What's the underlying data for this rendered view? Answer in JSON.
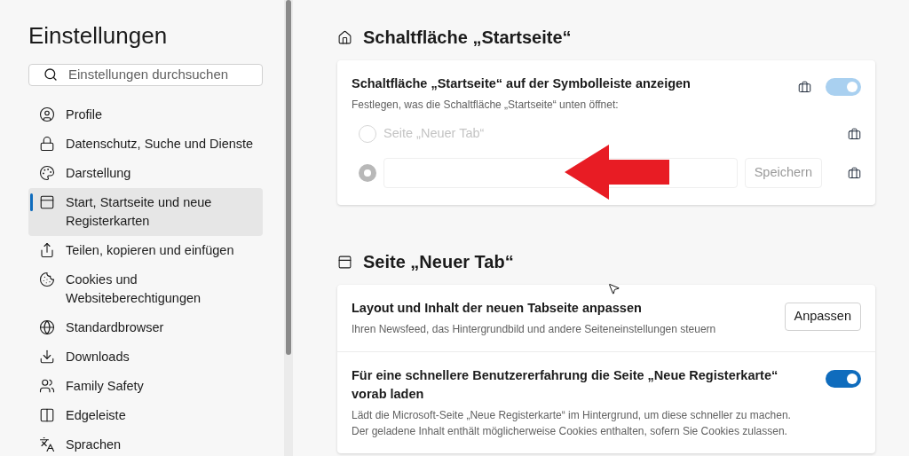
{
  "sidebar": {
    "title": "Einstellungen",
    "search": {
      "placeholder": "Einstellungen durchsuchen"
    },
    "items": [
      {
        "label": "Profile",
        "selected": false
      },
      {
        "label": "Datenschutz, Suche und Dienste",
        "selected": false
      },
      {
        "label": "Darstellung",
        "selected": false
      },
      {
        "label": "Start, Startseite und neue Registerkarten",
        "selected": true
      },
      {
        "label": "Teilen, kopieren und einfügen",
        "selected": false
      },
      {
        "label": "Cookies und Websiteberechtigungen",
        "selected": false
      },
      {
        "label": "Standardbrowser",
        "selected": false
      },
      {
        "label": "Downloads",
        "selected": false
      },
      {
        "label": "Family Safety",
        "selected": false
      },
      {
        "label": "Edgeleiste",
        "selected": false
      },
      {
        "label": "Sprachen",
        "selected": false
      }
    ]
  },
  "sections": [
    {
      "title": "Schaltfläche „Startseite“",
      "kind": "home",
      "rows": [
        {
          "kind": "toggle",
          "title": "Schaltfläche „Startseite“ auf der Symbolleiste anzeigen",
          "description": "Festlegen, was die Schaltfläche „Startseite“ unten öffnet:",
          "on": true,
          "disabled": true,
          "managed": true,
          "options": [
            {
              "kind": "label",
              "label": "Seite „Neuer Tab“",
              "selected": false,
              "disabled": true,
              "managed": true
            },
            {
              "kind": "url",
              "button": "Speichern",
              "selected": true,
              "disabled": true,
              "managed": true
            }
          ]
        }
      ]
    },
    {
      "title": "Seite „Neuer Tab“",
      "kind": "newtab",
      "rows": [
        {
          "kind": "button",
          "title": "Layout und Inhalt der neuen Tabseite anpassen",
          "description": "Ihren Newsfeed, das Hintergrundbild und andere Seiteneinstellungen steuern",
          "button": "Anpassen"
        },
        {
          "kind": "toggle",
          "title": "Für eine schnellere Benutzererfahrung die Seite „Neue Registerkarte“ vorab laden",
          "description": "Lädt die Microsoft-Seite „Neue Registerkarte“ im Hintergrund, um diese schneller zu machen. Der geladene Inhalt enthält möglicherweise Cookies enthalten, sofern Sie Cookies zulassen.",
          "on": true,
          "disabled": false
        }
      ]
    }
  ],
  "annotation": {
    "arrow": true
  }
}
